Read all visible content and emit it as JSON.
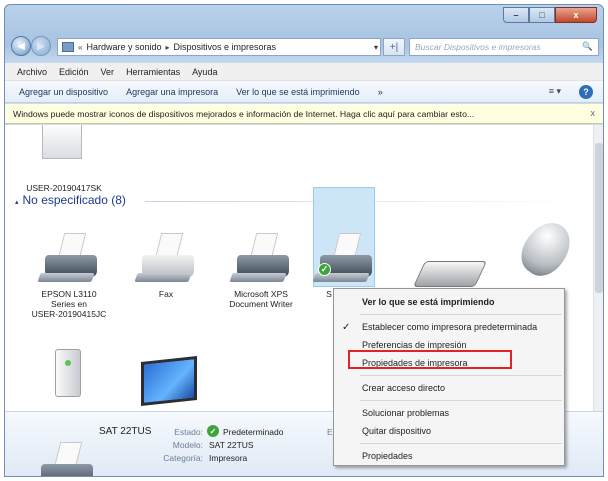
{
  "window": {
    "caption_buttons": {
      "minimize": "–",
      "maximize": "□",
      "close": "x"
    }
  },
  "address": {
    "icon": "control-panel-icon",
    "prefix": "«",
    "crumbs": [
      "Hardware y sonido",
      "Dispositivos e impresoras"
    ],
    "separator": "▸",
    "refresh_symbol": "+|",
    "search_placeholder": "Buscar Dispositivos e impresoras",
    "search_icon": "🔍"
  },
  "menubar": [
    "Archivo",
    "Edición",
    "Ver",
    "Herramientas",
    "Ayuda"
  ],
  "commandbar": {
    "items": [
      "Agregar un dispositivo",
      "Agregar una impresora",
      "Ver lo que se está imprimiendo"
    ],
    "more": "»",
    "view": "≡ ▾",
    "help": "?"
  },
  "infobar": {
    "text": "Windows puede mostrar iconos de dispositivos mejorados e información de Internet. Haga clic aquí para cambiar esto...",
    "close": "x"
  },
  "top_device": {
    "label": "USER-20190417SK"
  },
  "group": {
    "title": "No especificado (8)",
    "arrow": "▴"
  },
  "devices": [
    {
      "label": "EPSON L3110\nSeries en\nUSER-20190415JC"
    },
    {
      "label": "Fax"
    },
    {
      "label": "Microsoft XPS\nDocument Writer"
    },
    {
      "label": "S"
    }
  ],
  "context_menu": {
    "items": [
      {
        "label": "Ver lo que se está imprimiendo",
        "bold": true
      },
      {
        "label": "Establecer como impresora predeterminada",
        "checked": true
      },
      {
        "label": "Preferencias de impresión"
      },
      {
        "label": "Propiedades de impresora",
        "highlighted": true
      },
      {
        "label": "Crear acceso directo"
      },
      {
        "label": "Solucionar problemas"
      },
      {
        "label": "Quitar dispositivo"
      },
      {
        "label": "Propiedades"
      }
    ],
    "check_symbol": "✓",
    "highlight_color": "#e02424"
  },
  "details": {
    "name": "SAT 22TUS",
    "estado_key": "Estado:",
    "estado_value": "Predeterminado",
    "modelo_key": "Modelo:",
    "modelo_value": "SAT 22TUS",
    "categoria_key": "Categoría:",
    "categoria_value": "Impresora",
    "truncated": "Est"
  }
}
